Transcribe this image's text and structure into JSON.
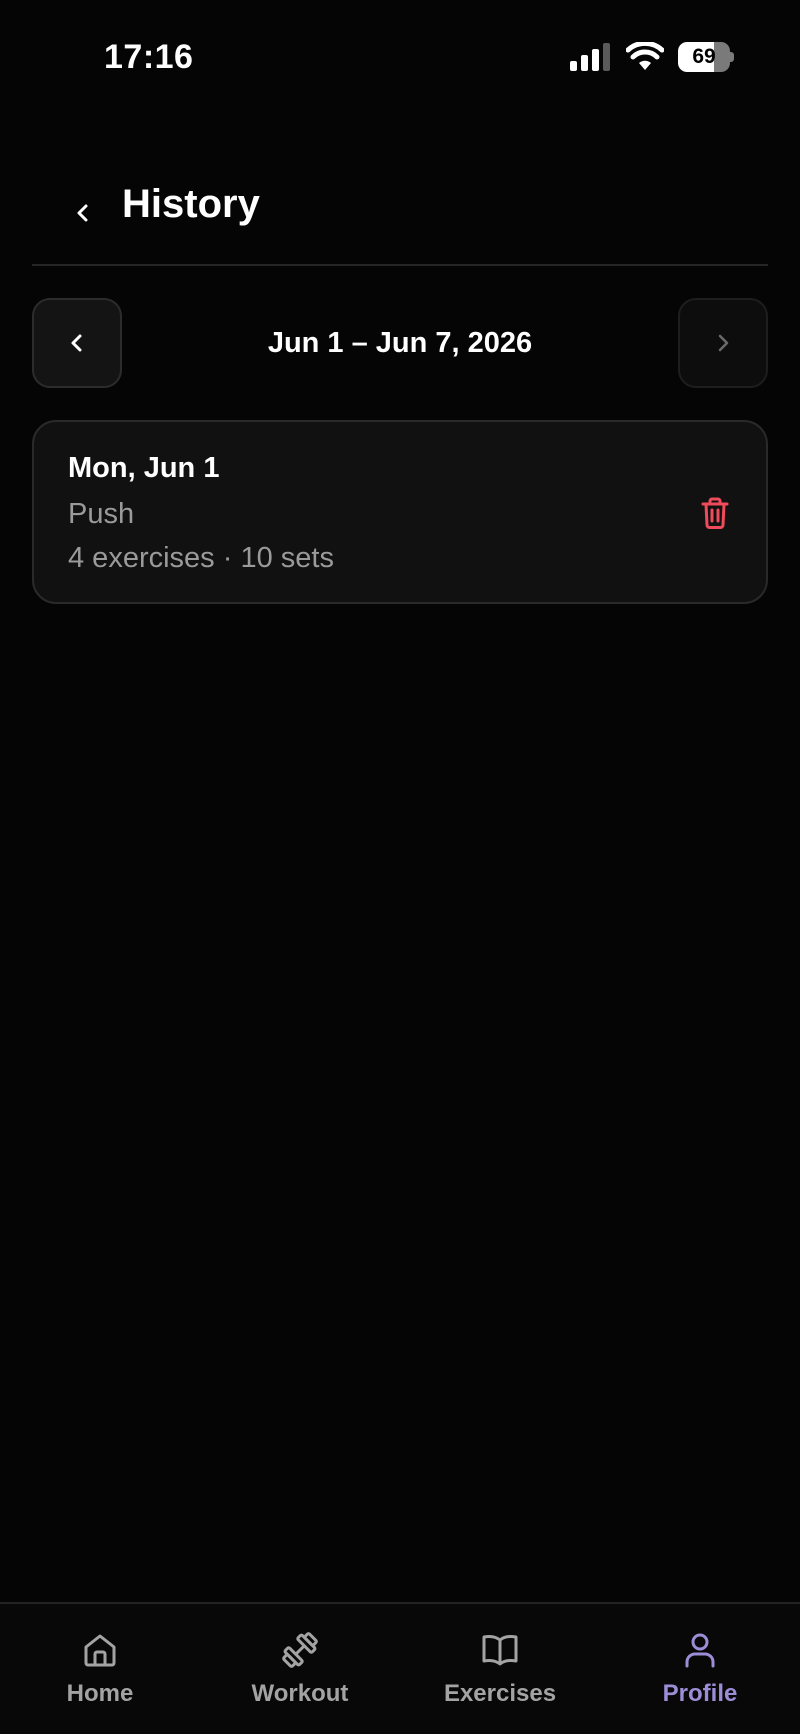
{
  "status_bar": {
    "time": "17:16",
    "battery_level": "69",
    "battery_fraction": 0.69
  },
  "header": {
    "title": "History"
  },
  "week_nav": {
    "range_label": "Jun 1 – Jun 7, 2026"
  },
  "workouts": [
    {
      "date": "Mon, Jun 1",
      "name": "Push",
      "meta": "4 exercises · 10 sets"
    }
  ],
  "bottom_nav": {
    "tabs": [
      {
        "label": "Home",
        "icon": "home-icon",
        "active": false
      },
      {
        "label": "Workout",
        "icon": "dumbbell-icon",
        "active": false
      },
      {
        "label": "Exercises",
        "icon": "book-icon",
        "active": false
      },
      {
        "label": "Profile",
        "icon": "user-icon",
        "active": true
      }
    ]
  },
  "colors": {
    "background": "#050505",
    "accent": "#9d8cd6",
    "danger": "#ef4b5a",
    "muted_text": "#9a9a9a"
  }
}
